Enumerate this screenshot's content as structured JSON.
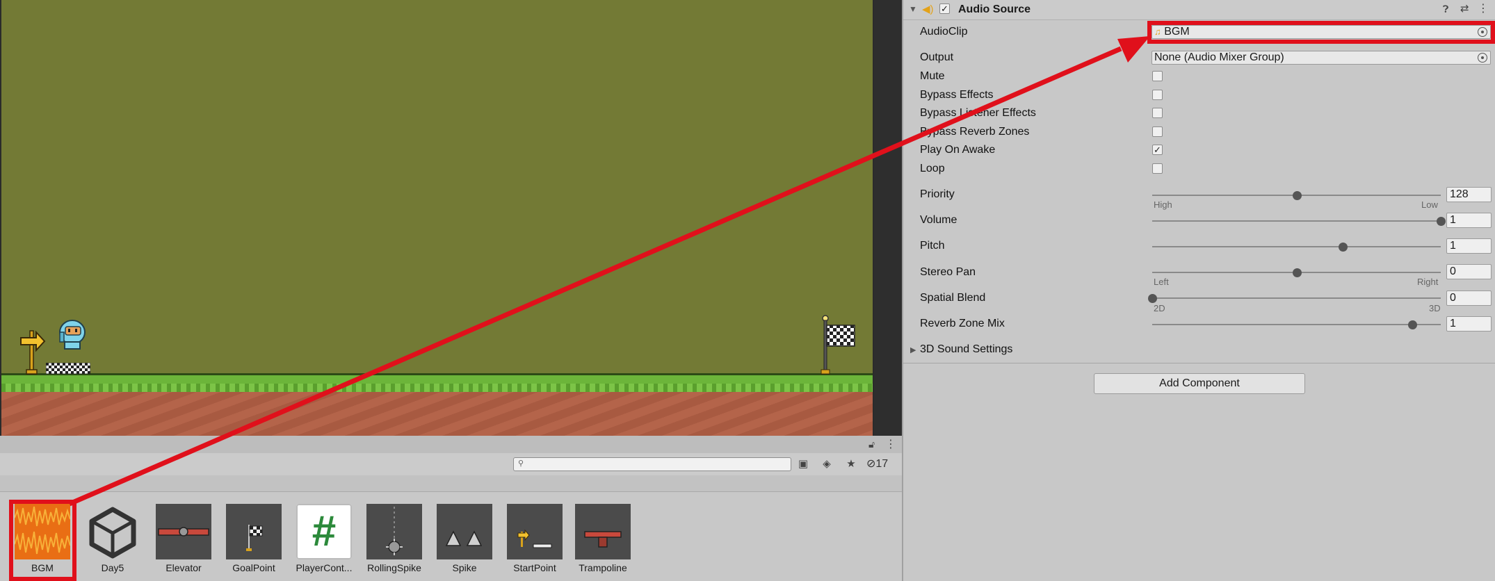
{
  "project": {
    "hidden_count": "17",
    "assets": [
      {
        "name": "BGM",
        "kind": "audio"
      },
      {
        "name": "Day5",
        "kind": "unity-scene"
      },
      {
        "name": "Elevator",
        "kind": "prefab"
      },
      {
        "name": "GoalPoint",
        "kind": "prefab"
      },
      {
        "name": "PlayerCont...",
        "kind": "csharp-script"
      },
      {
        "name": "RollingSpike",
        "kind": "prefab"
      },
      {
        "name": "Spike",
        "kind": "prefab"
      },
      {
        "name": "StartPoint",
        "kind": "prefab"
      },
      {
        "name": "Trampoline",
        "kind": "prefab"
      }
    ],
    "script_glyph": "#"
  },
  "inspector": {
    "component_title": "Audio Source",
    "component_enabled": true,
    "audio_clip": {
      "label": "AudioClip",
      "value": "BGM"
    },
    "output": {
      "label": "Output",
      "value": "None (Audio Mixer Group)"
    },
    "checkboxes": [
      {
        "label": "Mute",
        "checked": false
      },
      {
        "label": "Bypass Effects",
        "checked": false
      },
      {
        "label": "Bypass Listener Effects",
        "checked": false
      },
      {
        "label": "Bypass Reverb Zones",
        "checked": false
      },
      {
        "label": "Play On Awake",
        "checked": true
      },
      {
        "label": "Loop",
        "checked": false
      }
    ],
    "sliders": [
      {
        "label": "Priority",
        "value": "128",
        "fraction": 0.5,
        "min_label": "High",
        "max_label": "Low"
      },
      {
        "label": "Volume",
        "value": "1",
        "fraction": 1.0,
        "min_label": "",
        "max_label": ""
      },
      {
        "label": "Pitch",
        "value": "1",
        "fraction": 0.66,
        "min_label": "",
        "max_label": ""
      },
      {
        "label": "Stereo Pan",
        "value": "0",
        "fraction": 0.5,
        "min_label": "Left",
        "max_label": "Right"
      },
      {
        "label": "Spatial Blend",
        "value": "0",
        "fraction": 0.0,
        "min_label": "2D",
        "max_label": "3D"
      },
      {
        "label": "Reverb Zone Mix",
        "value": "1",
        "fraction": 0.9,
        "min_label": "",
        "max_label": ""
      }
    ],
    "sound_settings_label": "3D Sound Settings",
    "add_component_label": "Add Component"
  },
  "colors": {
    "annotation_red": "#e0101b",
    "game_background": "#737a35",
    "grass": "#6cb53a",
    "dirt": "#b4644a"
  }
}
